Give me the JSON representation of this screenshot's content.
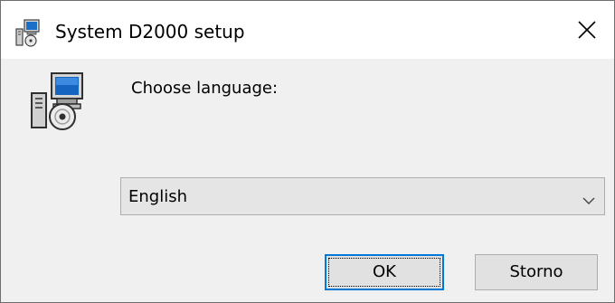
{
  "window": {
    "title": "System D2000 setup",
    "title_icon": "setup-app-icon",
    "close_icon": "close-icon"
  },
  "dialog": {
    "icon": "setup-cd-computer-icon",
    "prompt": "Choose language:",
    "language_select": {
      "selected": "English",
      "arrow_icon": "chevron-down-icon"
    },
    "ok_label": "OK",
    "cancel_label": "Storno"
  },
  "colors": {
    "titlebar": "#ffffff",
    "body": "#f0f0f0",
    "default_button_border": "#0078d7",
    "button": "#e1e1e1",
    "combo": "#e5e5e5"
  }
}
